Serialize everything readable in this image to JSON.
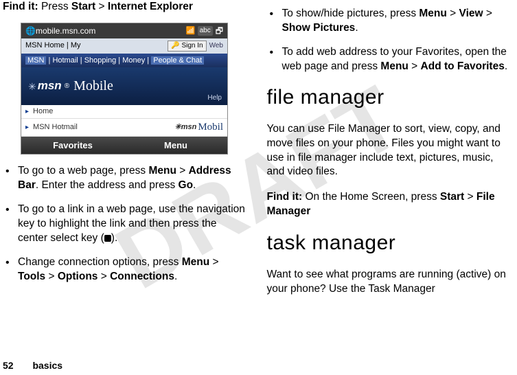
{
  "watermark": "DRAFT",
  "left": {
    "find_prefix": "Find it:",
    "find_text_1": " Press ",
    "find_b1": "Start",
    "find_sep": " > ",
    "find_b2": "Internet Explorer",
    "shot": {
      "url": "mobile.msn.com",
      "abc": "abc",
      "nav1_a": "MSN Home",
      "nav1_b": "My",
      "signin": "Sign In",
      "web": "Web",
      "nav2_a": "MSN",
      "nav2_b": "Hotmail",
      "nav2_c": "Shopping",
      "nav2_d": "Money",
      "nav2_e": "People & Chat",
      "msn": "msn",
      "mobile": "Mobile",
      "help": "Help",
      "row1": "Home",
      "row2": "MSN Hotmail",
      "row2_msn": "msn",
      "row2_mob": "Mobil",
      "sk_left": "Favorites",
      "sk_right": "Menu"
    },
    "b1_pre": "To go to a web page, press ",
    "b1_menu": "Menu",
    "b1_mid": " > ",
    "b1_addr": "Address Bar",
    "b1_post1": ". Enter the address and press ",
    "b1_go": "Go",
    "b1_post2": ".",
    "b2_pre": "To go to a link in a web page, use the navigation key to highlight the link and then press the center select key (",
    "b2_post": ").",
    "b3_pre": "Change connection options, press ",
    "b3_menu": "Menu",
    "b3_s": " > ",
    "b3_tools": "Tools",
    "b3_opts": "Options",
    "b3_conn": "Connections",
    "b3_post": "."
  },
  "right": {
    "r1_pre": "To show/hide pictures, press ",
    "r1_menu": "Menu",
    "r1_s": " > ",
    "r1_view": "View",
    "r1_sp": "Show Pictures",
    "r1_post": ".",
    "r2_pre": "To add web address to your Favorites, open the web page and press ",
    "r2_menu": "Menu",
    "r2_s": " > ",
    "r2_add": "Add to Favorites",
    "r2_post": ".",
    "h_fm": "file manager",
    "fm_para": "You can use File Manager to sort, view, copy, and move files on your phone. Files you might want to use in file manager include text, pictures, music, and video files.",
    "fm_find_pre": "Find it:",
    "fm_find_t1": " On the Home Screen, press ",
    "fm_find_b1": "Start",
    "fm_find_s": " > ",
    "fm_find_b2": "File Manager",
    "h_tm": "task manager",
    "tm_para": "Want to see what programs are running (active) on your phone? Use the Task Manager"
  },
  "footer": {
    "page": "52",
    "section": "basics"
  }
}
